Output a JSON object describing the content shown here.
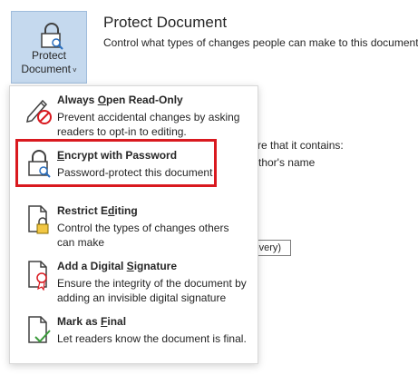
{
  "header": {
    "button_line1": "Protect",
    "button_line2": "Document",
    "button_chevron": "˅",
    "title": "Protect Document",
    "subtitle": "Control what types of changes people can make to this document."
  },
  "background": {
    "line1": "re that it contains:",
    "line2": "thor's name",
    "box": "covery)"
  },
  "menu": {
    "items": [
      {
        "title_pre": "Always ",
        "title_key": "O",
        "title_post": "pen Read-Only",
        "description": "Prevent accidental changes by asking readers to opt-in to editing.",
        "icon": "pencil-no-icon"
      },
      {
        "title_pre": "",
        "title_key": "E",
        "title_post": "ncrypt with Password",
        "description": "Password-protect this document",
        "icon": "lock-key-icon"
      },
      {
        "title_pre": "Restrict E",
        "title_key": "d",
        "title_post": "iting",
        "description": "Control the types of changes others can make",
        "icon": "doc-lock-icon"
      },
      {
        "title_pre": "Add a Digital ",
        "title_key": "S",
        "title_post": "ignature",
        "description": "Ensure the integrity of the document by adding an invisible digital signature",
        "icon": "doc-ribbon-icon"
      },
      {
        "title_pre": "Mark as ",
        "title_key": "F",
        "title_post": "inal",
        "description": "Let readers know the document is final.",
        "icon": "doc-check-icon"
      }
    ]
  },
  "colors": {
    "highlight": "#d9191f",
    "button_bg": "#c5d9ee",
    "accent_blue": "#2a6fbf"
  }
}
